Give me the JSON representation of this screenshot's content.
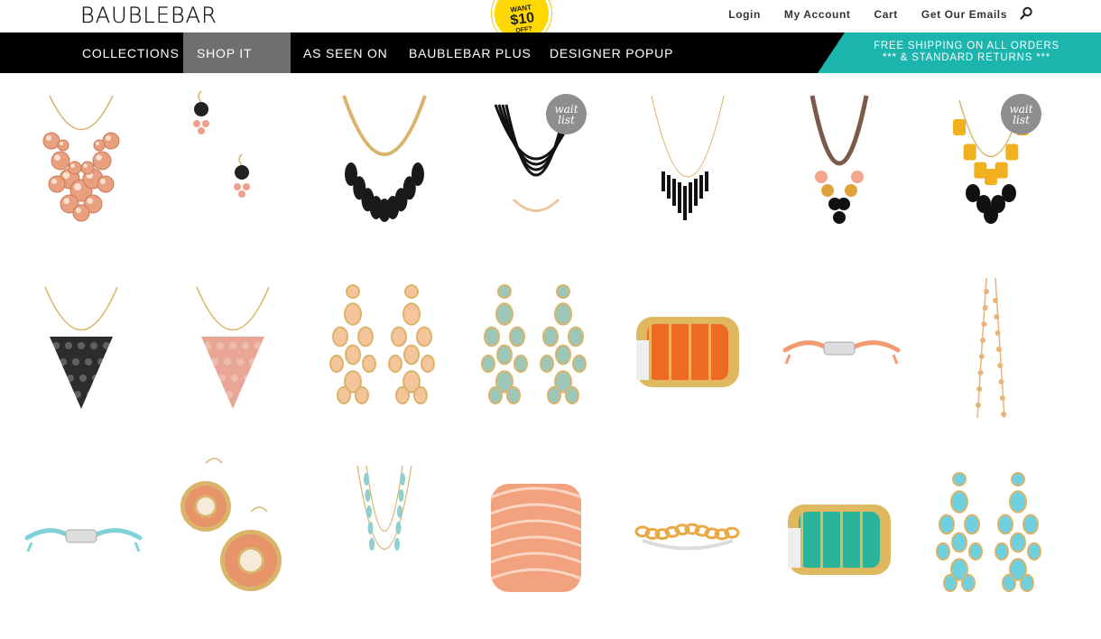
{
  "brand": {
    "logo_text": "BAUBLEBAR"
  },
  "promo": {
    "line1": "WANT",
    "line2": "$10",
    "line3": "OFF?"
  },
  "toplinks": [
    {
      "label": "Login"
    },
    {
      "label": "My Account"
    },
    {
      "label": "Cart"
    },
    {
      "label": "Get Our Emails"
    }
  ],
  "nav": [
    {
      "label": "COLLECTIONS",
      "active": false
    },
    {
      "label": "SHOP IT ALL",
      "active": true
    },
    {
      "label": "AS SEEN ON",
      "active": false
    },
    {
      "label": "BAUBLEBAR PLUS",
      "active": false
    },
    {
      "label": "DESIGNER POPUP",
      "active": false
    }
  ],
  "shipping": {
    "line1": "FREE SHIPPING ON ALL ORDERS",
    "line2": "*** & STANDARD RETURNS ***"
  },
  "waitlist_label": {
    "line1": "wait",
    "line2": "list"
  },
  "colors": {
    "nav_bg": "#000000",
    "nav_active": "#6f6f6f",
    "shipping_bg": "#1bb5ad",
    "promo_bg": "#ffd800",
    "waitlist_bg": "#8e8e8e"
  },
  "products": [
    {
      "kind": "bubble-necklace",
      "color": "#e8a07e",
      "waitlist": false
    },
    {
      "kind": "drop-earrings",
      "color": "#222222",
      "waitlist": false
    },
    {
      "kind": "teardrop-necklace",
      "color": "#1a1a1a",
      "waitlist": false
    },
    {
      "kind": "multistrand-necklace",
      "color": "#111111",
      "waitlist": true
    },
    {
      "kind": "spike-necklace",
      "color": "#111111",
      "waitlist": false
    },
    {
      "kind": "bead-necklace",
      "color": "#e0a23a",
      "waitlist": false
    },
    {
      "kind": "chunky-necklace",
      "color": "#f0b020",
      "waitlist": true
    },
    {
      "kind": "bib-necklace",
      "color": "#151515",
      "waitlist": false
    },
    {
      "kind": "bib-necklace",
      "color": "#e79c8a",
      "waitlist": false
    },
    {
      "kind": "chandelier-earrings",
      "color": "#f6c49a",
      "waitlist": false
    },
    {
      "kind": "chandelier-earrings",
      "color": "#9cc7b8",
      "waitlist": false
    },
    {
      "kind": "cuff",
      "color": "#ee6a22",
      "waitlist": false
    },
    {
      "kind": "cord-bracelet",
      "color": "#f39a70",
      "waitlist": false
    },
    {
      "kind": "chain-necklace",
      "color": "#e9b47a",
      "waitlist": false
    },
    {
      "kind": "cord-bracelet",
      "color": "#7fd3d8",
      "waitlist": false
    },
    {
      "kind": "medallion-earrings",
      "color": "#e8946a",
      "waitlist": false
    },
    {
      "kind": "layered-necklace",
      "color": "#8fcfd0",
      "waitlist": false
    },
    {
      "kind": "wrap-cuff",
      "color": "#f2a27e",
      "waitlist": false
    },
    {
      "kind": "chain-bracelet",
      "color": "#e9a945",
      "waitlist": false
    },
    {
      "kind": "cuff",
      "color": "#2bb39c",
      "waitlist": false
    },
    {
      "kind": "chandelier-earrings",
      "color": "#6fd0df",
      "waitlist": false
    }
  ]
}
